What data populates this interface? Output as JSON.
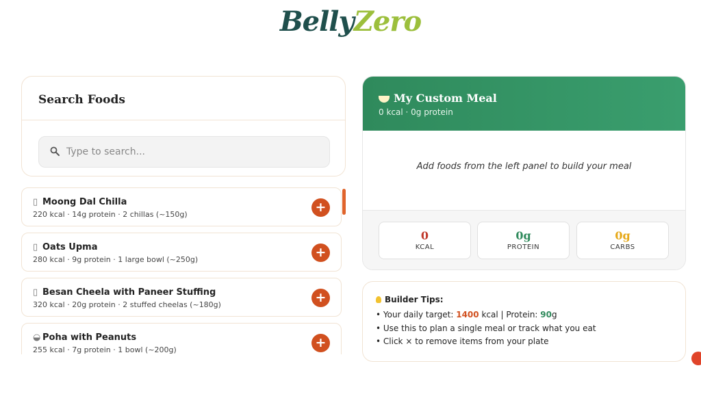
{
  "logo": {
    "part1": "Belly",
    "part2": "Zero"
  },
  "search": {
    "title": "Search Foods",
    "placeholder": "Type to search...",
    "icon": "search-icon"
  },
  "foods": [
    {
      "name": "Moong Dal Chilla",
      "meta": "220 kcal · 14g protein · 2 chillas (~150g)",
      "icon": "missing-glyph-icon",
      "icon_char": "▯"
    },
    {
      "name": "Oats Upma",
      "meta": "280 kcal · 9g protein · 1 large bowl (~250g)",
      "icon": "missing-glyph-icon",
      "icon_char": "▯"
    },
    {
      "name": "Besan Cheela with Paneer Stuffing",
      "meta": "320 kcal · 20g protein · 2 stuffed cheelas (~180g)",
      "icon": "missing-glyph-icon",
      "icon_char": "▯"
    },
    {
      "name": "Poha with Peanuts",
      "meta": "255 kcal · 7g protein · 1 bowl (~200g)",
      "icon": "bowl-icon",
      "icon_char": "◒"
    }
  ],
  "add_label": "+",
  "meal": {
    "title": "My Custom Meal",
    "subtitle": "0 kcal · 0g protein",
    "empty_message": "Add foods from the left panel to build your meal",
    "stats": [
      {
        "value": "0",
        "label": "KCAL",
        "color": "#c0392b"
      },
      {
        "value": "0g",
        "label": "PROTEIN",
        "color": "#2f8a5c"
      },
      {
        "value": "0g",
        "label": "CARBS",
        "color": "#e6a817"
      }
    ]
  },
  "tips": {
    "title": "Builder Tips:",
    "line1_prefix": "• Your daily target: ",
    "kcal_target": "1400",
    "line1_mid": " kcal | Protein: ",
    "protein_target": "90",
    "line1_suffix": "g",
    "line2": "• Use this to plan a single meal or track what you eat",
    "line3_prefix": "• Click ",
    "line3_icon": "×",
    "line3_suffix": " to remove items from your plate"
  },
  "colors": {
    "accent": "#d1501f",
    "green": "#2f8a5c",
    "logo_dark": "#1f4f4c",
    "logo_light": "#9cbf3c"
  }
}
